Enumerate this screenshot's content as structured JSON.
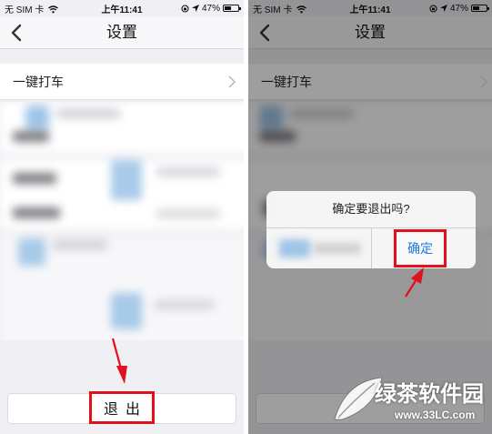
{
  "status_bar": {
    "carrier": "无 SIM 卡",
    "time": "上午11:41",
    "battery": "47%",
    "battery_level": 0.47,
    "icons": [
      "wifi-icon",
      "rotation-lock-icon",
      "location-icon",
      "battery-icon"
    ]
  },
  "nav": {
    "title": "设置",
    "back_icon": "chevron-left-icon"
  },
  "settings": {
    "first_row_label": "一键打车",
    "chevron_icon": "chevron-right-icon",
    "logout_label": "退出"
  },
  "alert": {
    "message": "确定要退出吗?",
    "confirm_label": "确定"
  },
  "annotations": {
    "highlight_color": "#e0101c"
  },
  "watermark": {
    "brand": "绿茶软件园",
    "url": "www.33LC.com"
  },
  "colors": {
    "background": "#efeff4",
    "link_blue": "#1a7ae0",
    "highlight_red": "#e0101c"
  }
}
